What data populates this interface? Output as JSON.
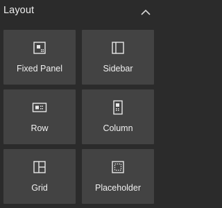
{
  "panel": {
    "title": "Layout",
    "collapse_icon": "chevron-up-icon"
  },
  "tiles": [
    {
      "label": "Fixed Panel",
      "icon": "fixed-panel-icon"
    },
    {
      "label": "Sidebar",
      "icon": "sidebar-icon"
    },
    {
      "label": "Row",
      "icon": "row-icon"
    },
    {
      "label": "Column",
      "icon": "column-icon"
    },
    {
      "label": "Grid",
      "icon": "grid-icon"
    },
    {
      "label": "Placeholder",
      "icon": "placeholder-icon"
    }
  ],
  "colors": {
    "background": "#2b2b2b",
    "tile": "#434343",
    "text": "#f0f0f0",
    "icon": "#e8e8e8"
  }
}
